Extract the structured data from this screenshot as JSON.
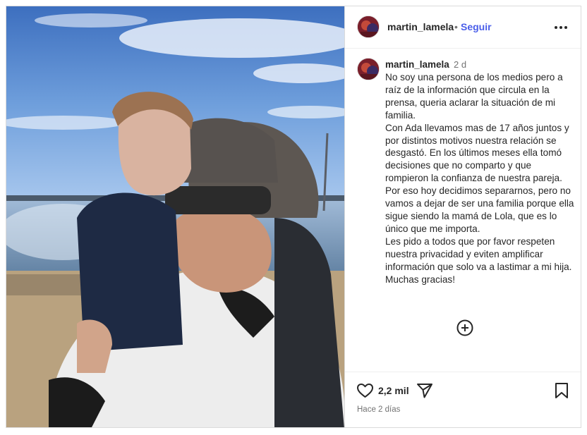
{
  "post": {
    "username": "martin_lamela",
    "follow_label": "Seguir",
    "separator": "•",
    "more_icon": "more-horizontal-icon",
    "caption_time": "2 d",
    "caption": "No soy una persona de los medios pero a raíz de la información que circula en la prensa, queria aclarar la situación de mi familia.\nCon Ada llevamos mas de 17 años juntos y por distintos motivos nuestra relación se desgastó. En los últimos meses ella tomó decisiones que no comparto y que rompieron la confianza de nuestra pareja. Por eso hoy decidimos separarnos, pero no vamos a dejar de ser una familia porque ella sigue siendo la mamá de Lola, que es lo único que me importa.\nLes pido a todos que por favor respeten nuestra privacidad y eviten amplificar información que solo va a lastimar a mi hija.\nMuchas gracias!",
    "likes": "2,2 mil",
    "time_ago": "Hace 2 días",
    "icons": {
      "like": "heart-icon",
      "share": "paper-plane-icon",
      "save": "bookmark-icon",
      "add": "plus-circle-icon"
    },
    "colors": {
      "follow": "#4a5ee9",
      "text": "#262626",
      "muted": "#737373",
      "border": "#dbdbdb"
    }
  }
}
